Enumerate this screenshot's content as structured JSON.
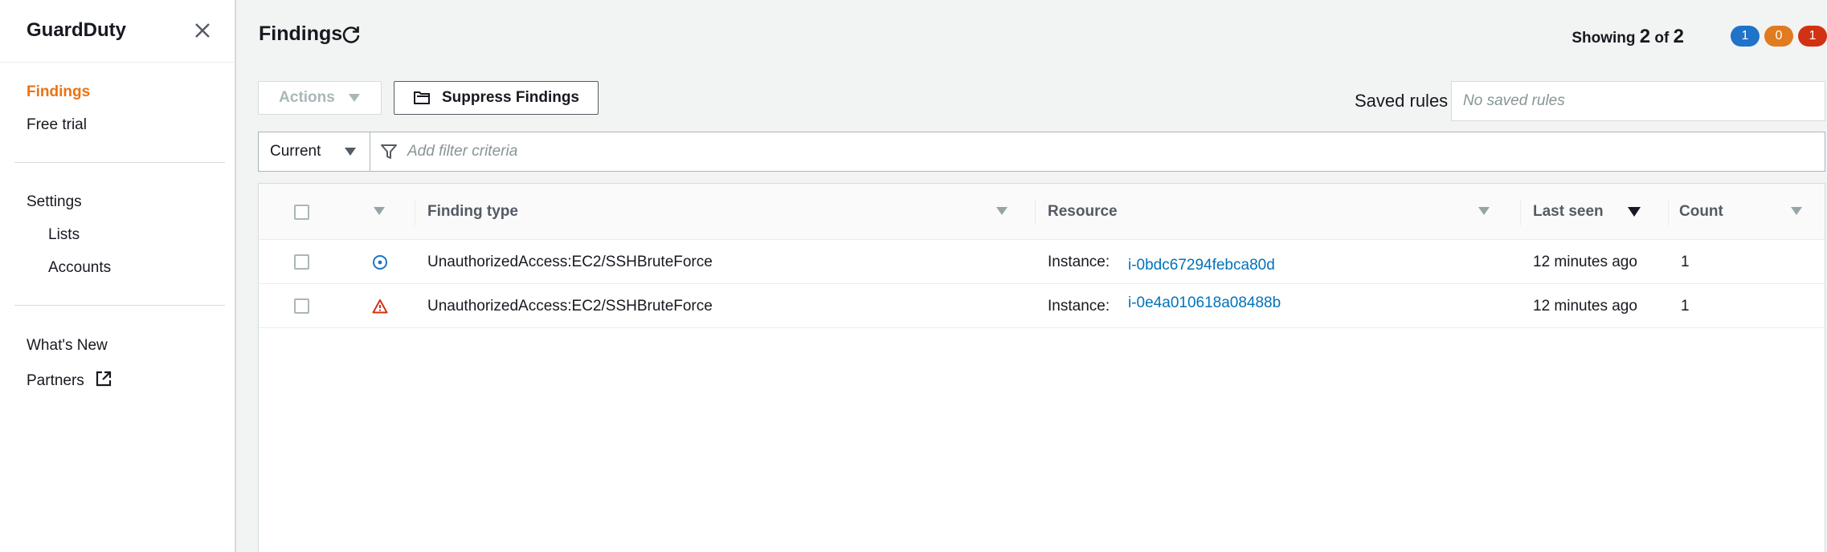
{
  "sidebar": {
    "title": "GuardDuty",
    "items": [
      {
        "label": "Findings"
      },
      {
        "label": "Free trial"
      },
      {
        "label": "Settings"
      },
      {
        "label": "Lists"
      },
      {
        "label": "Accounts"
      },
      {
        "label": "What's New"
      },
      {
        "label": "Partners"
      }
    ]
  },
  "header": {
    "title": "Findings",
    "showing_label": "Showing",
    "showing_count": "2",
    "showing_of": "of",
    "showing_total": "2",
    "badges": [
      {
        "value": "1",
        "color": "#1f73c9"
      },
      {
        "value": "0",
        "color": "#e07b1f"
      },
      {
        "value": "1",
        "color": "#d13212"
      }
    ]
  },
  "toolbar": {
    "actions_label": "Actions",
    "suppress_label": "Suppress Findings",
    "saved_rules_label": "Saved rules",
    "saved_rules_placeholder": "No saved rules"
  },
  "filter": {
    "selected": "Current",
    "placeholder": "Add filter criteria"
  },
  "table": {
    "columns": [
      "Finding type",
      "Resource",
      "Last seen",
      "Count"
    ],
    "rows": [
      {
        "severity": "low",
        "finding_type": "UnauthorizedAccess:EC2/SSHBruteForce",
        "resource_prefix": "Instance:",
        "resource_id": "i-0bdc67294febca80d",
        "last_seen": "12 minutes ago",
        "count": "1"
      },
      {
        "severity": "high",
        "finding_type": "UnauthorizedAccess:EC2/SSHBruteForce",
        "resource_prefix": "Instance:",
        "resource_id": "i-0e4a010618a08488b",
        "last_seen": "12 minutes ago",
        "count": "1"
      }
    ]
  }
}
